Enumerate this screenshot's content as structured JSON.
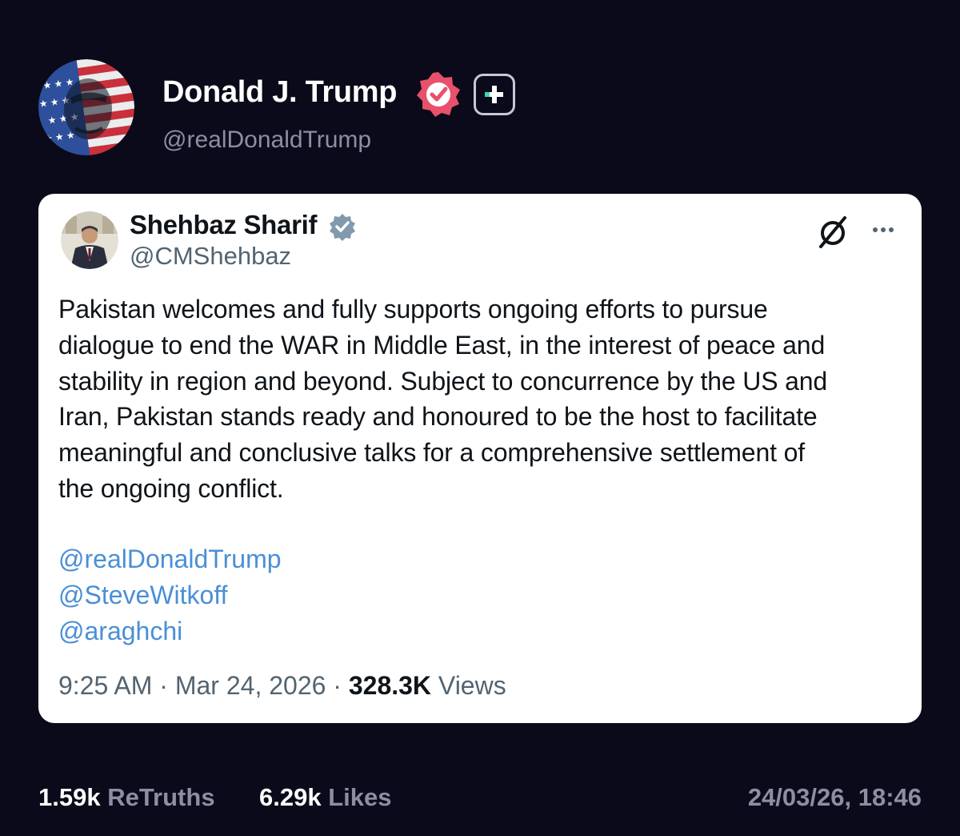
{
  "post": {
    "author_name": "Donald J. Trump",
    "author_handle": "@realDonaldTrump",
    "avatar_icon": "flag-portrait-avatar",
    "verified_icon": "verified-badge-icon",
    "plus_icon": "plus-badge-icon"
  },
  "quoted": {
    "author_name": "Shehbaz Sharif",
    "author_handle": "@CMShehbaz",
    "body_lines": [
      "Pakistan welcomes and fully supports ongoing efforts to pursue",
      "dialogue to end the WAR in Middle East, in the interest of peace and",
      "stability in region and beyond. Subject to concurrence by the US and",
      "Iran, Pakistan stands ready and honoured to be the host to facilitate",
      "meaningful and conclusive talks for a comprehensive settlement of",
      "the ongoing conflict."
    ],
    "mentions": [
      "@realDonaldTrump",
      "@SteveWitkoff",
      "@araghchi"
    ],
    "time": "9:25 AM",
    "separator": "·",
    "date": "Mar 24, 2026",
    "views_count": "328.3K",
    "views_label": "Views"
  },
  "footer": {
    "retruths_count": "1.59k",
    "retruths_label": "ReTruths",
    "likes_count": "6.29k",
    "likes_label": "Likes",
    "timestamp": "24/03/26, 18:46"
  },
  "colors": {
    "background": "#0a0a1a",
    "verified_pink": "#e8506c",
    "plus_teal": "#3dd6b0",
    "mention_blue": "#4a8fd6",
    "x_verified": "#829aab"
  }
}
